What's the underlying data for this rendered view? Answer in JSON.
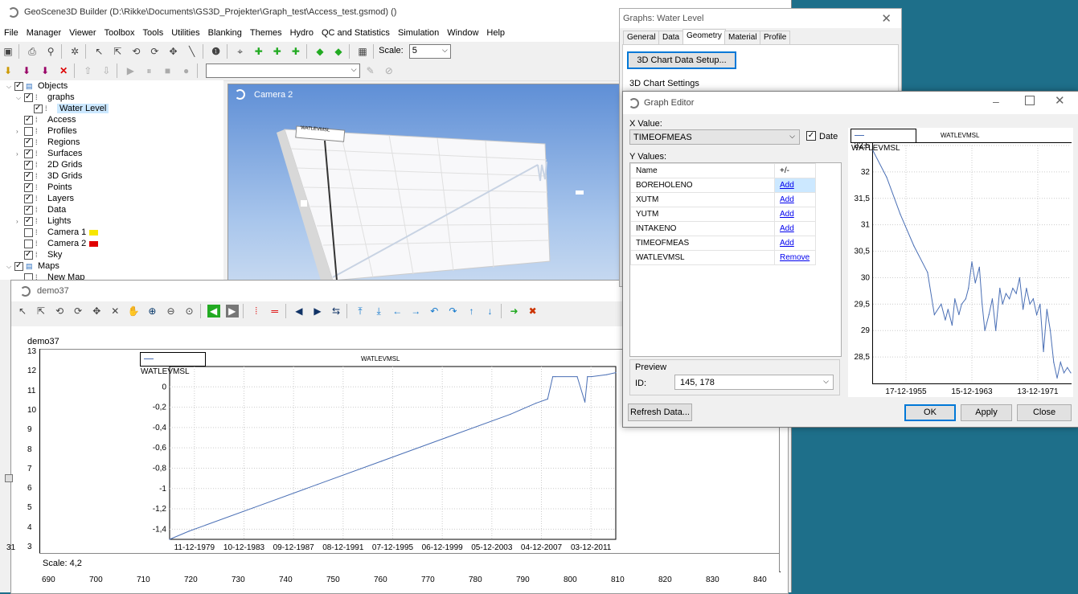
{
  "app": {
    "title": "GeoScene3D Builder (D:\\Rikke\\Documents\\GS3D_Projekter\\Graph_test\\Access_test.gsmod) ()",
    "menu": [
      "File",
      "Manager",
      "Viewer",
      "Toolbox",
      "Tools",
      "Utilities",
      "Blanking",
      "Themes",
      "Hydro",
      "QC and Statistics",
      "Simulation",
      "Window",
      "Help"
    ],
    "scale_label": "Scale:",
    "scale_value": "5"
  },
  "tree": [
    {
      "label": "Objects",
      "depth": 0,
      "checked": true,
      "expand": "v"
    },
    {
      "label": "graphs",
      "depth": 1,
      "checked": true,
      "expand": "v"
    },
    {
      "label": "Water Level",
      "depth": 2,
      "checked": true,
      "expand": "",
      "selected": true
    },
    {
      "label": "Access",
      "depth": 1,
      "checked": true,
      "expand": ""
    },
    {
      "label": "Profiles",
      "depth": 1,
      "checked": false,
      "expand": ">"
    },
    {
      "label": "Regions",
      "depth": 1,
      "checked": true,
      "expand": ""
    },
    {
      "label": "Surfaces",
      "depth": 1,
      "checked": true,
      "expand": ">"
    },
    {
      "label": "2D Grids",
      "depth": 1,
      "checked": true,
      "expand": ""
    },
    {
      "label": "3D Grids",
      "depth": 1,
      "checked": true,
      "expand": ""
    },
    {
      "label": "Points",
      "depth": 1,
      "checked": true,
      "expand": ""
    },
    {
      "label": "Layers",
      "depth": 1,
      "checked": true,
      "expand": ""
    },
    {
      "label": "Data",
      "depth": 1,
      "checked": true,
      "expand": ""
    },
    {
      "label": "Lights",
      "depth": 1,
      "checked": true,
      "expand": ">"
    },
    {
      "label": "Camera 1",
      "depth": 1,
      "checked": false,
      "expand": "",
      "swatch": "#f7e600"
    },
    {
      "label": "Camera 2",
      "depth": 1,
      "checked": false,
      "expand": "",
      "swatch": "#e00000"
    },
    {
      "label": "Sky",
      "depth": 1,
      "checked": true,
      "expand": ""
    },
    {
      "label": "Maps",
      "depth": 0,
      "checked": true,
      "expand": "v"
    },
    {
      "label": "New Map",
      "depth": 1,
      "checked": false,
      "expand": ""
    }
  ],
  "camera": {
    "title": "Camera 2",
    "mini_legend": "WATLEVMSL"
  },
  "demo": {
    "title": "demo37",
    "plot_label": "demo37",
    "scale_text": "Scale: 4,2",
    "left_y_ticks": [
      "13",
      "12",
      "11",
      "10",
      "9",
      "8",
      "7",
      "6",
      "5",
      "4",
      "3"
    ],
    "bottom_x_ticks": [
      "690",
      "700",
      "710",
      "720",
      "730",
      "740",
      "750",
      "760",
      "770",
      "780",
      "790",
      "800",
      "810",
      "820",
      "830",
      "840"
    ],
    "inner_legend": "WATLEVMSL",
    "inner_title": "WATLEVMSL",
    "side_marker": "31"
  },
  "chart_data": [
    {
      "type": "line",
      "title": "WATLEVMSL",
      "xlabel": "",
      "ylabel": "",
      "x_tick_labels": [
        "11-12-1979",
        "10-12-1983",
        "09-12-1987",
        "08-12-1991",
        "07-12-1995",
        "06-12-1999",
        "05-12-2003",
        "04-12-2007",
        "03-12-2011"
      ],
      "y_tick_labels": [
        "0",
        "-0,2",
        "-0,4",
        "-0,6",
        "-0,8",
        "-1",
        "-1,2",
        "-1,4"
      ],
      "ylim": [
        -1.5,
        0.2
      ],
      "series": [
        {
          "name": "WATLEVMSL",
          "x": [
            1978.5,
            1980,
            1985,
            1990,
            1995,
            2000,
            2005,
            2007.0,
            2007.9,
            2008.3,
            2008.5,
            2010.2,
            2010.8,
            2011.0,
            2011.3,
            2012.5,
            2013.2
          ],
          "values": [
            -1.5,
            -1.42,
            -1.19,
            -0.96,
            -0.73,
            -0.5,
            -0.27,
            -0.16,
            -0.12,
            0.1,
            0.1,
            0.1,
            -0.15,
            0.1,
            0.1,
            0.12,
            0.14
          ]
        }
      ]
    },
    {
      "type": "line",
      "title": "WATLEVMSL",
      "xlabel": "",
      "ylabel": "",
      "x_tick_labels": [
        "17-12-1955",
        "15-12-1963",
        "13-12-1971"
      ],
      "y_tick_labels": [
        "32,5",
        "32",
        "31,5",
        "31",
        "30,5",
        "30",
        "29,5",
        "29",
        "28,5"
      ],
      "ylim": [
        28,
        32.5
      ],
      "series": [
        {
          "name": "WATLEVMSL",
          "x": [
            1950,
            1952,
            1954,
            1956,
            1958,
            1959,
            1960,
            1960.6,
            1961,
            1961.6,
            1962,
            1962.6,
            1963,
            1963.6,
            1964,
            1964.5,
            1965,
            1965.6,
            1966,
            1966.4,
            1967,
            1967.5,
            1968,
            1968.6,
            1969,
            1969.5,
            1970,
            1970.5,
            1971,
            1971.5,
            1972,
            1972.5,
            1973,
            1973.5,
            1974,
            1974.5,
            1975,
            1975.5,
            1976,
            1976.5,
            1977,
            1977.5,
            1978,
            1978.5,
            1979
          ],
          "values": [
            32.4,
            31.9,
            31.2,
            30.6,
            30.1,
            29.3,
            29.5,
            29.2,
            29.4,
            29.1,
            29.6,
            29.3,
            29.5,
            29.6,
            29.8,
            30.3,
            29.9,
            30.2,
            29.5,
            29.0,
            29.3,
            29.6,
            29.0,
            29.8,
            29.5,
            29.7,
            29.6,
            29.8,
            29.7,
            30.0,
            29.4,
            29.8,
            29.5,
            29.6,
            29.3,
            29.5,
            28.6,
            29.4,
            29.0,
            28.4,
            28.1,
            28.4,
            28.2,
            28.3,
            28.2
          ]
        }
      ]
    }
  ],
  "graphs_window": {
    "title": "Graphs: Water Level",
    "tabs": [
      "General",
      "Data",
      "Geometry",
      "Material",
      "Profile"
    ],
    "setup_button": "3D Chart Data Setup...",
    "group_label": "3D Chart Settings"
  },
  "graph_editor": {
    "title": "Graph Editor",
    "x_value_label": "X Value:",
    "x_value": "TIMEOFMEAS",
    "date_label": "Date",
    "y_values_label": "Y Values:",
    "col_name": "Name",
    "col_action": "+/-",
    "rows": [
      {
        "name": "BOREHOLENO",
        "action": "Add"
      },
      {
        "name": "XUTM",
        "action": "Add"
      },
      {
        "name": "YUTM",
        "action": "Add"
      },
      {
        "name": "INTAKENO",
        "action": "Add"
      },
      {
        "name": "TIMEOFMEAS",
        "action": "Add"
      },
      {
        "name": "WATLEVMSL",
        "action": "Remove"
      }
    ],
    "preview_label": "Preview",
    "id_label": "ID:",
    "id_value": "145, 178",
    "refresh_button": "Refresh Data...",
    "ok_button": "OK",
    "apply_button": "Apply",
    "close_button": "Close",
    "legend": "WATLEVMSL",
    "chart_title": "WATLEVMSL"
  }
}
